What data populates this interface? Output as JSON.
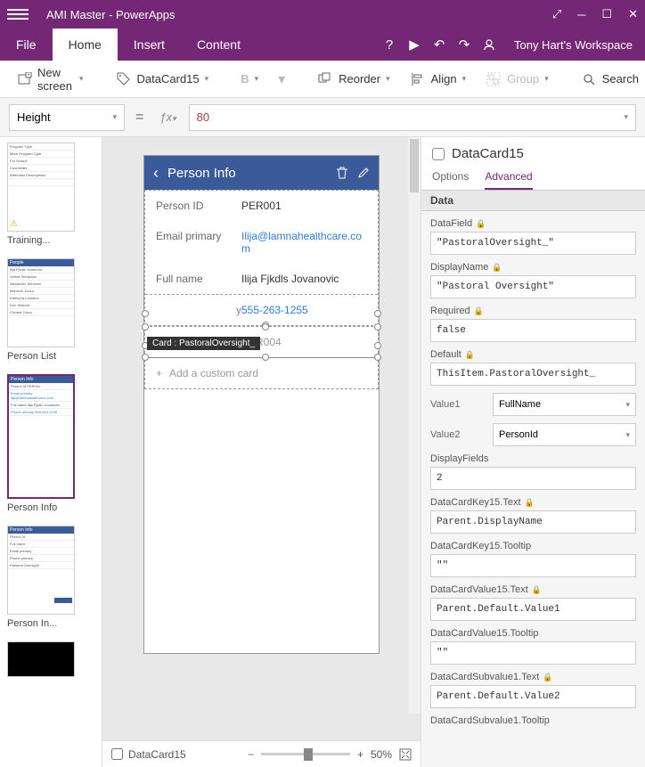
{
  "titlebar": {
    "title": "AMI Master - PowerApps"
  },
  "ribbon": {
    "file": "File",
    "home": "Home",
    "insert": "Insert",
    "content": "Content",
    "user": "Tony Hart's Workspace"
  },
  "toolbar": {
    "newscreen": "New screen",
    "datacard": "DataCard15",
    "reorder": "Reorder",
    "align": "Align",
    "group": "Group",
    "search": "Search"
  },
  "formula": {
    "property": "Height",
    "fx": "fx",
    "value": "80"
  },
  "screens": {
    "s1": "Training...",
    "s2": "Person List",
    "s3": "Person Info",
    "s4": "Person In..."
  },
  "thumb2": {
    "hdr": "People",
    "r1": "Ilija Fjkdls Jovanovic",
    "r2": "Selma Somjonov",
    "r3": "Alexander Tikhonov",
    "r4": "Mauricio Jonza",
    "r5": "Kateryna Lobodov",
    "r6": "Ron Wolford",
    "r7": "Christel Groor"
  },
  "thumb3": {
    "hdr": "Person Info",
    "l1": "Person Id",
    "v1": "PER001",
    "l2": "Email primary",
    "v2": "ilija@lamnahealthcare.com",
    "l3": "Full name",
    "v3": "Ilija Fjkdls Jovanovic",
    "l4": "Phone primary",
    "v4": "555-263-1255"
  },
  "thumb4": {
    "hdr": "Person Info"
  },
  "phone": {
    "title": "Person Info",
    "tooltip": "Card : PastoralOversight_",
    "rows": {
      "pid_l": "Person ID",
      "pid_v": "PER001",
      "email_l": "Email primary",
      "email_v": "Ilija@lamnahealthcare.com",
      "name_l": "Full name",
      "name_v": "Ilija Fjkdls Jovanovic",
      "phone_l": "Phone primary",
      "phone_l_trunc": "y",
      "phone_v": "555-263-1255",
      "past_l": "Pastoral Oversi...",
      "past_v": "PER004"
    },
    "addcard": "Add a custom card"
  },
  "status": {
    "datacard": "DataCard15",
    "zoom": "50%"
  },
  "props": {
    "name": "DataCard15",
    "tab_options": "Options",
    "tab_advanced": "Advanced",
    "section_data": "Data",
    "fields": {
      "DataField_l": "DataField",
      "DataField_v": "\"PastoralOversight_\"",
      "DisplayName_l": "DisplayName",
      "DisplayName_v": "\"Pastoral Oversight\"",
      "Required_l": "Required",
      "Required_v": "false",
      "Default_l": "Default",
      "Default_v": "ThisItem.PastoralOversight_",
      "Value1_l": "Value1",
      "Value1_v": "FullName",
      "Value2_l": "Value2",
      "Value2_v": "PersonId",
      "DisplayFields_l": "DisplayFields",
      "DisplayFields_v": "2",
      "DCKey_l": "DataCardKey15.Text",
      "DCKey_v": "Parent.DisplayName",
      "DCKeyTT_l": "DataCardKey15.Tooltip",
      "DCKeyTT_v": "\"\"",
      "DCVal_l": "DataCardValue15.Text",
      "DCVal_v": "Parent.Default.Value1",
      "DCValTT_l": "DataCardValue15.Tooltip",
      "DCValTT_v": "\"\"",
      "DCSub_l": "DataCardSubvalue1.Text",
      "DCSub_v": "Parent.Default.Value2",
      "DCSubTT_l": "DataCardSubvalue1.Tooltip"
    }
  }
}
